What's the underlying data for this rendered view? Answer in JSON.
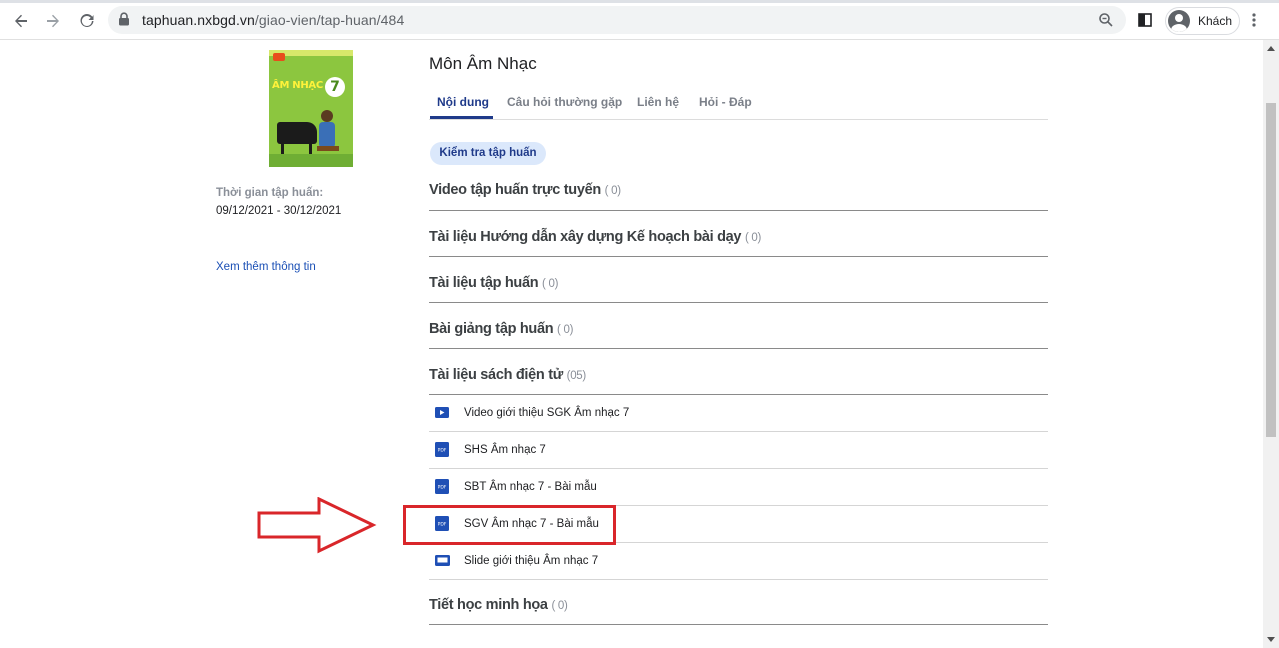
{
  "browser": {
    "url_host": "taphuan.nxbgd.vn",
    "url_path": "/giao-vien/tap-huan/484",
    "profile_name": "Khách"
  },
  "sidebar": {
    "training_time_label": "Thời gian tập huấn:",
    "training_time_value": "09/12/2021 - 30/12/2021",
    "more_info_link": "Xem thêm thông tin",
    "book_cover_title": "ÂM NHẠC",
    "book_cover_number": "7"
  },
  "main": {
    "subject_title": "Môn Âm Nhạc",
    "tabs": [
      {
        "label": "Nội dung",
        "active": true
      },
      {
        "label": "Câu hỏi thường gặp",
        "active": false
      },
      {
        "label": "Liên hệ",
        "active": false
      },
      {
        "label": "Hỏi - Đáp",
        "active": false
      }
    ],
    "check_button": "Kiểm tra tập huấn",
    "sections": [
      {
        "title": "Video tập huấn trực tuyến",
        "count": "( 0)"
      },
      {
        "title": "Tài liệu Hướng dẫn xây dựng Kế hoạch bài dạy",
        "count": "( 0)"
      },
      {
        "title": "Tài liệu tập huấn",
        "count": "( 0)"
      },
      {
        "title": "Bài giảng tập huấn",
        "count": "( 0)"
      },
      {
        "title": "Tài liệu sách điện tử",
        "count": "(05)"
      },
      {
        "title": "Tiết học minh họa",
        "count": "( 0)"
      }
    ],
    "ebook_items": [
      {
        "label": "Video giới thiệu SGK Âm nhạc 7",
        "icon": "video-icon"
      },
      {
        "label": "SHS Âm nhạc 7",
        "icon": "pdf-icon"
      },
      {
        "label": "SBT Âm nhạc 7 - Bài mẫu",
        "icon": "pdf-icon"
      },
      {
        "label": "SGV Âm nhạc 7 - Bài mẫu",
        "icon": "pdf-icon"
      },
      {
        "label": "Slide giới thiệu Âm nhạc 7",
        "icon": "slide-icon"
      }
    ],
    "pdf_icon_text": "PDF"
  },
  "colors": {
    "accent": "#1f3a8a",
    "highlight": "#d9262a",
    "link": "#1a4fb5"
  }
}
